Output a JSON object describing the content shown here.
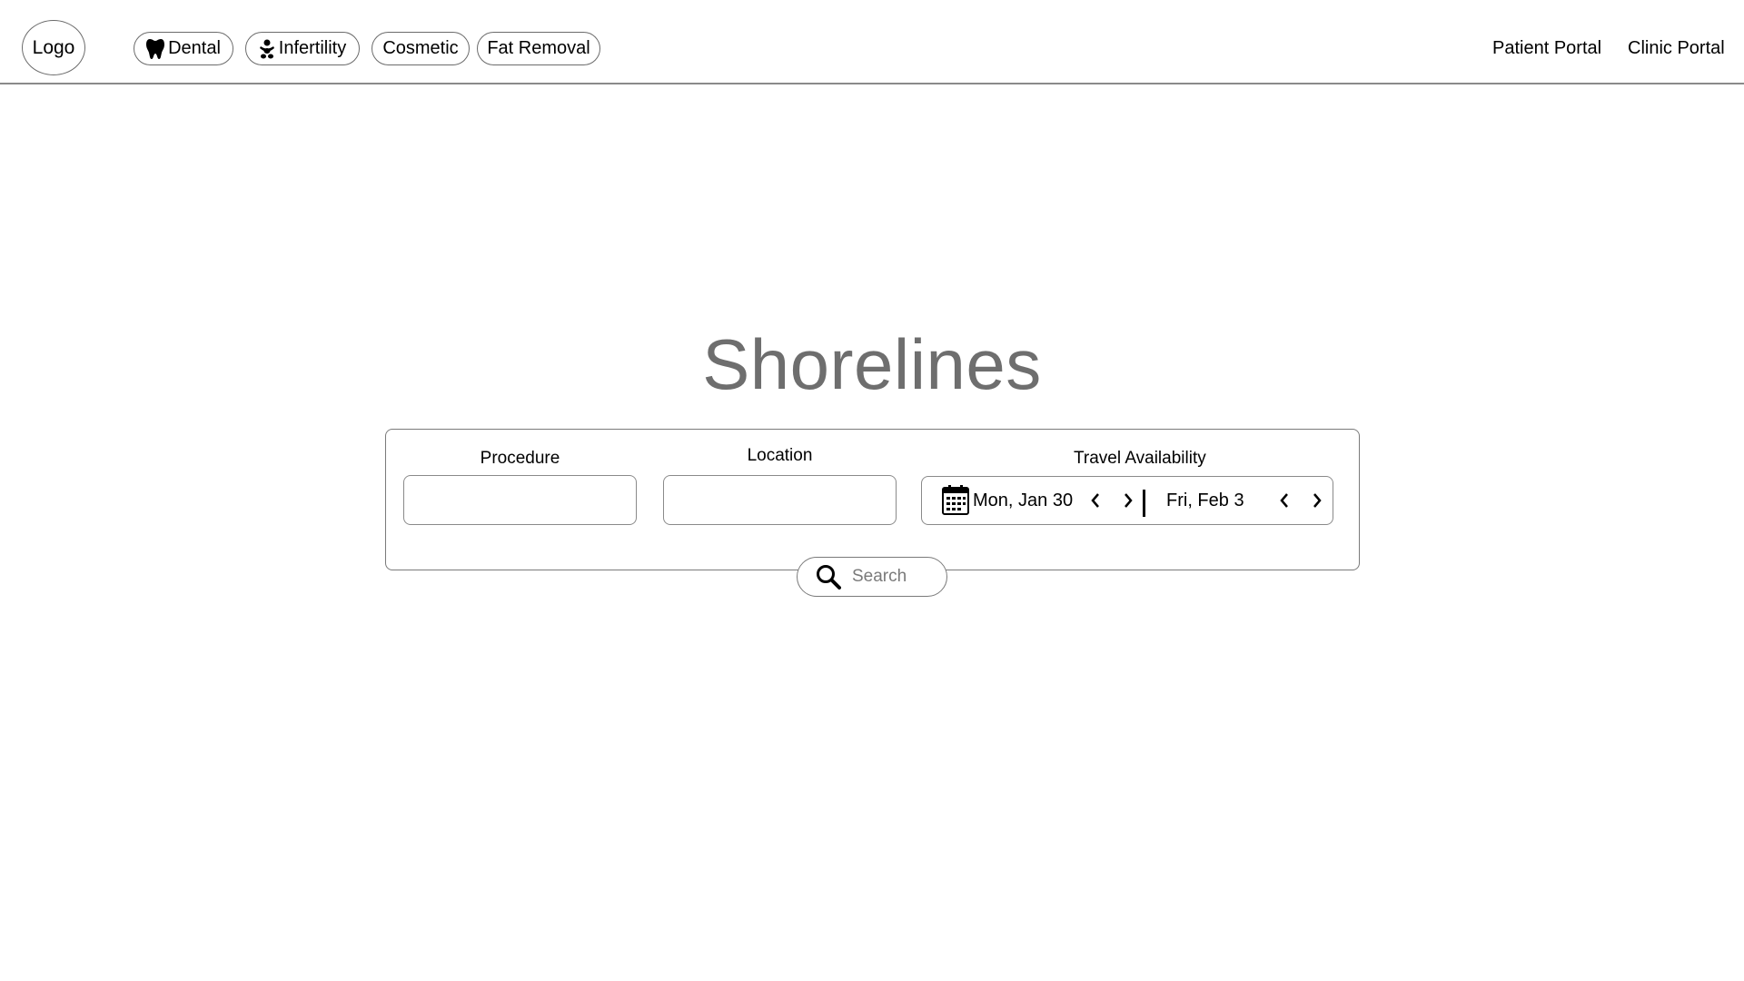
{
  "header": {
    "logo_label": "Logo",
    "categories": [
      {
        "label": "Dental",
        "icon": "tooth-icon"
      },
      {
        "label": "Infertility",
        "icon": "baby-icon"
      },
      {
        "label": "Cosmetic",
        "icon": ""
      },
      {
        "label": "Fat Removal",
        "icon": ""
      }
    ],
    "links": [
      "Patient Portal",
      "Clinic Portal"
    ]
  },
  "main": {
    "title": "Shorelines",
    "search_form": {
      "procedure_label": "Procedure",
      "procedure_value": "",
      "location_label": "Location",
      "location_value": "",
      "travel_label": "Travel Availability",
      "start_date": "Mon, Jan 30",
      "end_date": "Fri, Feb 3",
      "calendar_icon": "calendar-icon",
      "search_label": "Search",
      "search_icon": "search-icon"
    }
  },
  "colors": {
    "title": "#6e6e6e",
    "border": "#7a7a7a",
    "search_text": "#7a7a7a"
  }
}
